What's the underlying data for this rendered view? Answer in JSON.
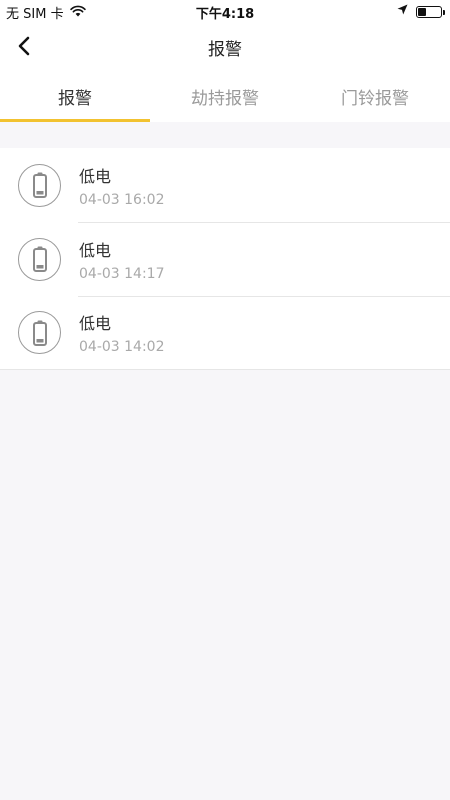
{
  "status_bar": {
    "carrier": "无 SIM 卡",
    "time": "下午4:18",
    "wifi_icon": "wifi-icon",
    "location_icon": "location-arrow-icon",
    "battery_level": 0.35
  },
  "nav": {
    "back_icon": "chevron-left-icon",
    "title": "报警"
  },
  "tabs": [
    {
      "label": "报警",
      "active": true
    },
    {
      "label": "劫持报警",
      "active": false
    },
    {
      "label": "门铃报警",
      "active": false
    }
  ],
  "alarms": [
    {
      "title": "低电",
      "time": "04-03 16:02",
      "icon": "low-battery-icon"
    },
    {
      "title": "低电",
      "time": "04-03 14:17",
      "icon": "low-battery-icon"
    },
    {
      "title": "低电",
      "time": "04-03 14:02",
      "icon": "low-battery-icon"
    }
  ],
  "colors": {
    "accent": "#f2c230",
    "background": "#f7f6f9",
    "inactive_tab": "#9a9a9a"
  }
}
